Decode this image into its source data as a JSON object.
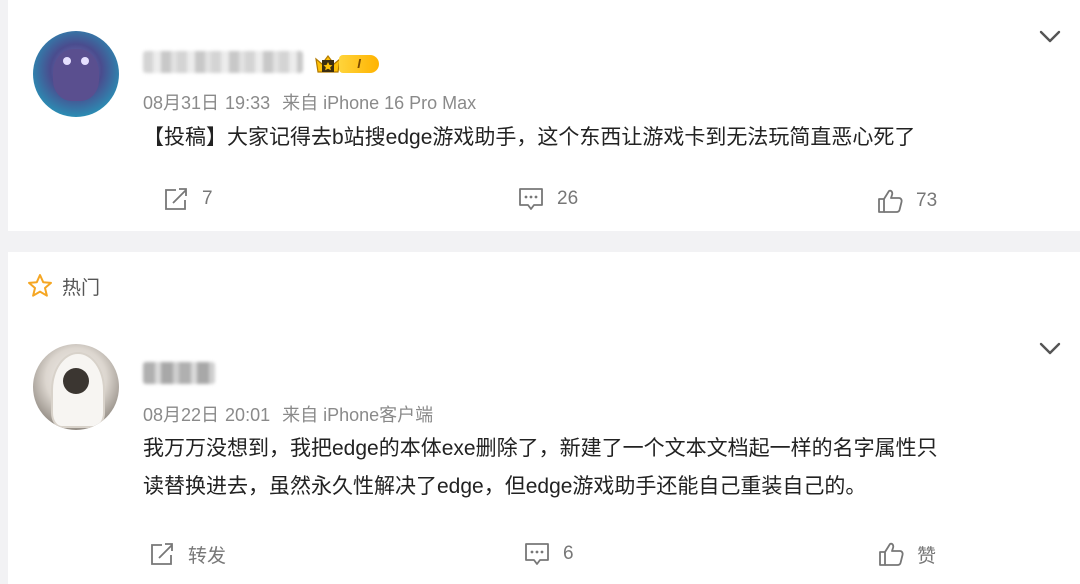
{
  "hot_label": "热门",
  "posts": [
    {
      "name": "",
      "badge_level": "I",
      "date": "08月31日",
      "time": "19:33",
      "source": "来自 iPhone 16 Pro Max",
      "content_lines": [
        "【投稿】大家记得去b站搜edge游戏助手，这个东西让游戏卡到无法玩简直恶心死了"
      ],
      "repost": "7",
      "comments": "26",
      "likes": "73"
    },
    {
      "name": "",
      "date": "08月22日",
      "time": "20:01",
      "source": "来自 iPhone客户端",
      "content_lines": [
        "我万万没想到，我把edge的本体exe删除了，新建了一个文本文档起一样的名字属性只",
        "读替换进去，虽然永久性解决了edge，但edge游戏助手还能自己重装自己的。"
      ],
      "repost": "转发",
      "comments": "6",
      "likes": "赞"
    }
  ],
  "icons": {
    "repost": "repost-icon",
    "comment": "comment-icon",
    "like": "thumbs-up-icon",
    "expand": "chevron-down-icon",
    "hot": "star-icon"
  },
  "colors": {
    "background": "#f2f2f4",
    "card": "#ffffff",
    "hot_star": "#f5a623",
    "badge": "#ffc107"
  }
}
